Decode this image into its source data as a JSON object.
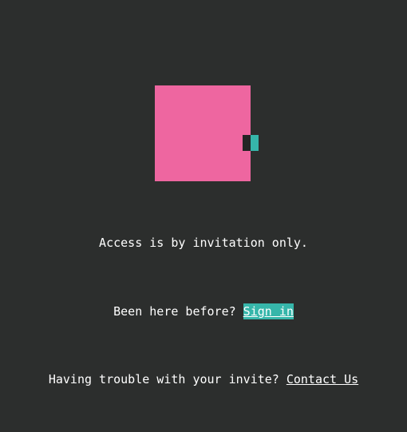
{
  "logo": {
    "icon": "pixel-logo-icon",
    "main_color": "#ee66a0",
    "accent_dark": "#242525",
    "accent_teal": "#36b6aa"
  },
  "message": {
    "access_text": "Access is by invitation only.",
    "returning_prefix": "Been here before? ",
    "sign_in_label": "Sign in",
    "trouble_prefix": "Having trouble with your invite? ",
    "contact_label": "Contact Us"
  },
  "colors": {
    "background": "#2c2e2d",
    "text": "#ffffff",
    "link_highlight": "#36b6aa"
  }
}
